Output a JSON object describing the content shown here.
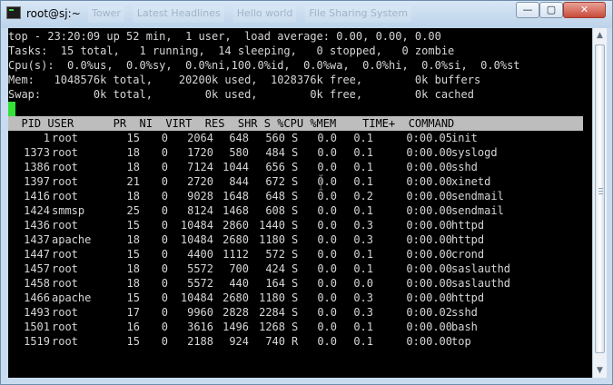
{
  "window": {
    "title": "root@sj:~",
    "ghost_tabs": [
      "Tower",
      "Latest Headlines",
      "Hello world",
      "File Sharing System"
    ],
    "buttons": {
      "minimize": "—",
      "maximize": "▢",
      "close": "✕"
    }
  },
  "terminal": {
    "top_lines": [
      "top - 23:20:09 up 52 min,  1 user,  load average: 0.00, 0.00, 0.00",
      "Tasks:  15 total,   1 running,  14 sleeping,   0 stopped,   0 zombie",
      "Cpu(s):  0.0%us,  0.0%sy,  0.0%ni,100.0%id,  0.0%wa,  0.0%hi,  0.0%si,  0.0%st",
      "Mem:   1048576k total,    20200k used,  1028376k free,        0k buffers",
      "Swap:        0k total,        0k used,        0k free,        0k cached"
    ],
    "header_line": "  PID USER      PR  NI  VIRT  RES  SHR S %CPU %MEM    TIME+  COMMAND",
    "processes": [
      {
        "pid": "1",
        "user": "root",
        "pr": "15",
        "ni": "0",
        "virt": "2064",
        "res": "648",
        "shr": "560",
        "s": "S",
        "cpu": "0.0",
        "mem": "0.1",
        "time": "0:00.05",
        "command": "init"
      },
      {
        "pid": "1373",
        "user": "root",
        "pr": "18",
        "ni": "0",
        "virt": "1720",
        "res": "580",
        "shr": "484",
        "s": "S",
        "cpu": "0.0",
        "mem": "0.1",
        "time": "0:00.00",
        "command": "syslogd"
      },
      {
        "pid": "1386",
        "user": "root",
        "pr": "18",
        "ni": "0",
        "virt": "7124",
        "res": "1044",
        "shr": "656",
        "s": "S",
        "cpu": "0.0",
        "mem": "0.1",
        "time": "0:00.00",
        "command": "sshd"
      },
      {
        "pid": "1397",
        "user": "root",
        "pr": "21",
        "ni": "0",
        "virt": "2720",
        "res": "844",
        "shr": "672",
        "s": "S",
        "cpu": "0.0",
        "mem": "0.1",
        "time": "0:00.00",
        "command": "xinetd"
      },
      {
        "pid": "1416",
        "user": "root",
        "pr": "18",
        "ni": "0",
        "virt": "9028",
        "res": "1648",
        "shr": "648",
        "s": "S",
        "cpu": "0.0",
        "mem": "0.2",
        "time": "0:00.00",
        "command": "sendmail"
      },
      {
        "pid": "1424",
        "user": "smmsp",
        "pr": "25",
        "ni": "0",
        "virt": "8124",
        "res": "1468",
        "shr": "608",
        "s": "S",
        "cpu": "0.0",
        "mem": "0.1",
        "time": "0:00.00",
        "command": "sendmail"
      },
      {
        "pid": "1436",
        "user": "root",
        "pr": "15",
        "ni": "0",
        "virt": "10484",
        "res": "2860",
        "shr": "1440",
        "s": "S",
        "cpu": "0.0",
        "mem": "0.3",
        "time": "0:00.00",
        "command": "httpd"
      },
      {
        "pid": "1437",
        "user": "apache",
        "pr": "18",
        "ni": "0",
        "virt": "10484",
        "res": "2680",
        "shr": "1180",
        "s": "S",
        "cpu": "0.0",
        "mem": "0.3",
        "time": "0:00.00",
        "command": "httpd"
      },
      {
        "pid": "1447",
        "user": "root",
        "pr": "15",
        "ni": "0",
        "virt": "4400",
        "res": "1112",
        "shr": "572",
        "s": "S",
        "cpu": "0.0",
        "mem": "0.1",
        "time": "0:00.00",
        "command": "crond"
      },
      {
        "pid": "1457",
        "user": "root",
        "pr": "18",
        "ni": "0",
        "virt": "5572",
        "res": "700",
        "shr": "424",
        "s": "S",
        "cpu": "0.0",
        "mem": "0.1",
        "time": "0:00.00",
        "command": "saslauthd"
      },
      {
        "pid": "1458",
        "user": "root",
        "pr": "18",
        "ni": "0",
        "virt": "5572",
        "res": "440",
        "shr": "164",
        "s": "S",
        "cpu": "0.0",
        "mem": "0.0",
        "time": "0:00.00",
        "command": "saslauthd"
      },
      {
        "pid": "1466",
        "user": "apache",
        "pr": "15",
        "ni": "0",
        "virt": "10484",
        "res": "2680",
        "shr": "1180",
        "s": "S",
        "cpu": "0.0",
        "mem": "0.3",
        "time": "0:00.00",
        "command": "httpd"
      },
      {
        "pid": "1493",
        "user": "root",
        "pr": "17",
        "ni": "0",
        "virt": "9960",
        "res": "2828",
        "shr": "2284",
        "s": "S",
        "cpu": "0.0",
        "mem": "0.3",
        "time": "0:00.02",
        "command": "sshd"
      },
      {
        "pid": "1501",
        "user": "root",
        "pr": "16",
        "ni": "0",
        "virt": "3616",
        "res": "1496",
        "shr": "1268",
        "s": "S",
        "cpu": "0.0",
        "mem": "0.1",
        "time": "0:00.00",
        "command": "bash"
      },
      {
        "pid": "1519",
        "user": "root",
        "pr": "15",
        "ni": "0",
        "virt": "2188",
        "res": "924",
        "shr": "740",
        "s": "R",
        "cpu": "0.0",
        "mem": "0.1",
        "time": "0:00.00",
        "command": "top"
      }
    ]
  },
  "colors": {
    "terminal_bg": "#000000",
    "terminal_text": "#d6d6d6",
    "cursor": "#35e038",
    "header_bg": "#bdbdbd",
    "titlebar": "#c9dcef"
  }
}
